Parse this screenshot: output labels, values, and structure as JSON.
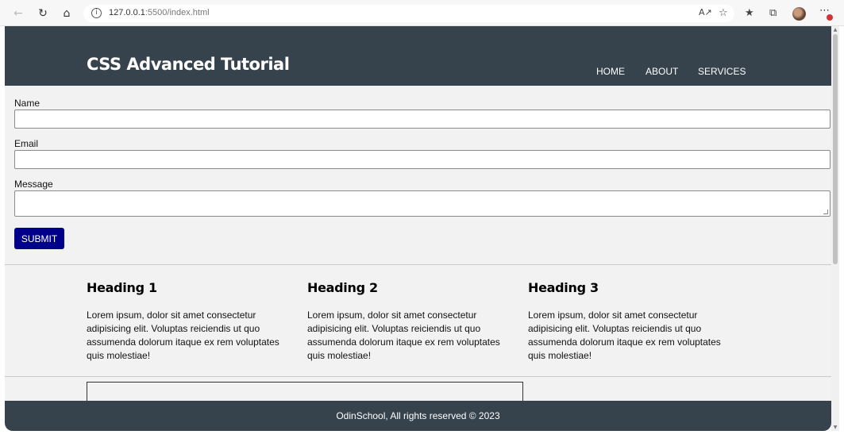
{
  "browser": {
    "back_icon": "arrow-left-icon",
    "reload_icon": "refresh-icon",
    "home_icon": "home-icon",
    "info_icon": "i",
    "url_host": "127.0.0.1",
    "url_rest": ":5500/index.html",
    "toolbar_icons": [
      "read-aloud-icon",
      "favorite-add-icon",
      "favorites-icon",
      "collections-icon",
      "profile-avatar-icon",
      "more-icon"
    ]
  },
  "header": {
    "title": "CSS Advanced Tutorial",
    "nav": [
      {
        "label": "HOME"
      },
      {
        "label": "ABOUT"
      },
      {
        "label": "SERVICES"
      }
    ],
    "background": "#37434c"
  },
  "form": {
    "name_label": "Name",
    "name_value": "",
    "email_label": "Email",
    "email_value": "",
    "message_label": "Message",
    "message_value": "",
    "submit_label": "SUBMIT",
    "submit_color": "#00008b"
  },
  "columns": [
    {
      "heading": "Heading 1",
      "text": "Lorem ipsum, dolor sit amet consectetur adipisicing elit. Voluptas reiciendis ut quo assumenda dolorum itaque ex rem voluptates quis molestiae!"
    },
    {
      "heading": "Heading 2",
      "text": "Lorem ipsum, dolor sit amet consectetur adipisicing elit. Voluptas reiciendis ut quo assumenda dolorum itaque ex rem voluptates quis molestiae!"
    },
    {
      "heading": "Heading 3",
      "text": "Lorem ipsum, dolor sit amet consectetur adipisicing elit. Voluptas reiciendis ut quo assumenda dolorum itaque ex rem voluptates quis molestiae!"
    }
  ],
  "footer": {
    "text": "OdinSchool, All rights reserved © 2023"
  }
}
